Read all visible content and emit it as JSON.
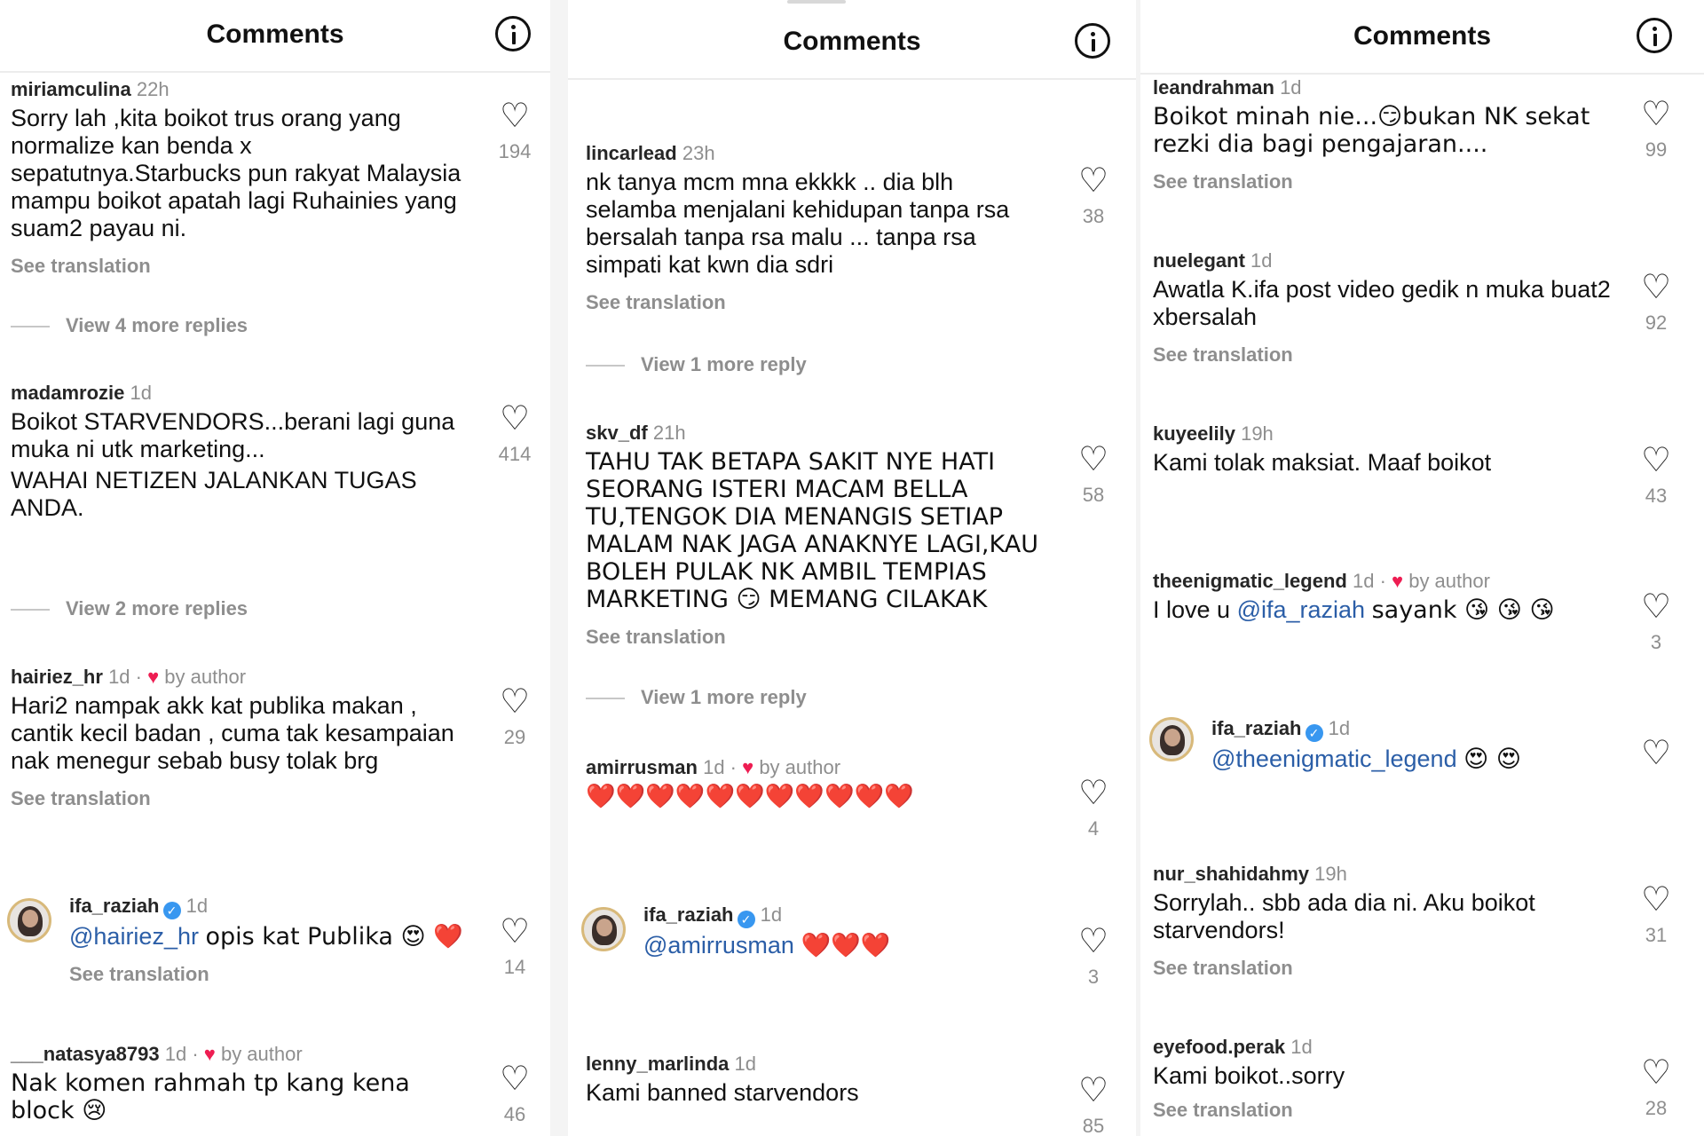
{
  "panels": [
    {
      "title": "Comments",
      "comments": [
        {
          "user": "miriamculina",
          "time": "22h",
          "author_tag": "",
          "text": "Sorry lah ,kita boikot trus orang yang normalize kan benda x sepatutnya.Starbucks pun rakyat Malaysia mampu boikot apatah lagi Ruhainies yang suam2 payau ni.",
          "see_translation": "See translation",
          "more_replies": "View 4 more replies",
          "likes": "194"
        },
        {
          "user": "madamrozie",
          "time": "1d",
          "author_tag": "",
          "text": "Boikot STARVENDORS...berani lagi guna muka ni utk marketing...",
          "text2": "WAHAI NETIZEN JALANKAN TUGAS ANDA.",
          "more_replies": "View 2 more replies",
          "likes": "414"
        },
        {
          "user": "hairiez_hr",
          "time": "1d",
          "author_tag": "by author",
          "text": "Hari2 nampak akk kat publika makan , cantik kecil badan , cuma tak kesampaian nak menegur sebab busy tolak brg",
          "see_translation": "See translation",
          "likes": "29"
        },
        {
          "user": "ifa_raziah",
          "time": "1d",
          "mention": "@hairiez_hr",
          "text": "opis kat Publika 😍 ❤️",
          "see_translation": "See translation",
          "likes": "14"
        },
        {
          "user": "___natasya8793",
          "time": "1d",
          "author_tag": "by author",
          "text": "Nak komen rahmah tp kang kena block 😢",
          "likes": "46"
        }
      ]
    },
    {
      "title": "Comments",
      "comments": [
        {
          "user": "lincarlead",
          "time": "23h",
          "text": "nk tanya mcm mna ekkkk .. dia blh selamba menjalani kehidupan tanpa rsa bersalah tanpa rsa malu ... tanpa rsa simpati kat kwn dia sdri",
          "see_translation": "See translation",
          "more_replies": "View 1 more reply",
          "likes": "38"
        },
        {
          "user": "skv_df",
          "time": "21h",
          "text": "TAHU TAK BETAPA SAKIT NYE HATI SEORANG ISTERI MACAM BELLA TU,TENGOK DIA MENANGIS SETIAP MALAM NAK JAGA ANAKNYE LAGI,KAU BOLEH PULAK NK AMBIL TEMPIAS MARKETING 😏 MEMANG CILAKAK",
          "see_translation": "See translation",
          "more_replies": "View 1 more reply",
          "likes": "58"
        },
        {
          "user": "amirrusman",
          "time": "1d",
          "author_tag": "by author",
          "text": "❤️❤️❤️❤️❤️❤️❤️❤️❤️❤️❤️",
          "likes": "4"
        },
        {
          "user": "ifa_raziah",
          "time": "1d",
          "mention": "@amirrusman",
          "text": "❤️❤️❤️",
          "likes": "3"
        },
        {
          "user": "lenny_marlinda",
          "time": "1d",
          "text": "Kami banned starvendors",
          "likes": "85"
        }
      ]
    },
    {
      "title": "Comments",
      "comments": [
        {
          "user": "leandrahman",
          "time": "1d",
          "text": "Boikot minah nie...😏bukan NK sekat rezki dia bagi pengajaran....",
          "see_translation": "See translation",
          "likes": "99"
        },
        {
          "user": "nuelegant",
          "time": "1d",
          "text": "Awatla K.ifa post video gedik n muka buat2 xbersalah",
          "see_translation": "See translation",
          "likes": "92"
        },
        {
          "user": "kuyeelily",
          "time": "19h",
          "text": "Kami tolak maksiat. Maaf boikot",
          "likes": "43"
        },
        {
          "user": "theenigmatic_legend",
          "time": "1d",
          "author_tag": "by author",
          "mention_prefix": "I love u",
          "mention": "@ifa_raziah",
          "text": "sayank 😘 😘 😘",
          "likes": "3"
        },
        {
          "user": "ifa_raziah",
          "time": "1d",
          "mention": "@theenigmatic_legend",
          "text": "😍 😍",
          "likes": ""
        },
        {
          "user": "nur_shahidahmy",
          "time": "19h",
          "text": "Sorrylah.. sbb ada dia ni. Aku boikot starvendors!",
          "see_translation": "See translation",
          "likes": "31"
        },
        {
          "user": "eyefood.perak",
          "time": "1d",
          "text": "Kami boikot..sorry",
          "see_translation": "See translation",
          "likes": "28"
        }
      ]
    }
  ],
  "icons": {
    "info": "info-icon",
    "like": "heart-outline-icon",
    "author_like": "heart-filled-icon",
    "verified": "verified-badge-icon"
  },
  "colors": {
    "mention": "#2b5ea7",
    "muted": "#8e8e8e",
    "heart": "#ee1d52",
    "verified": "#3897f0"
  },
  "watermark": "murai"
}
